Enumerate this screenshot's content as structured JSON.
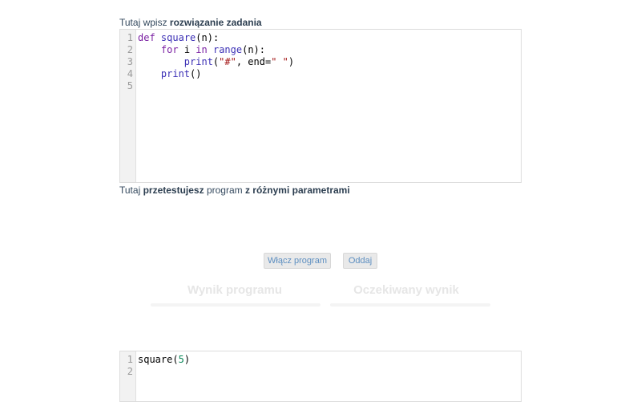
{
  "solution": {
    "label_prefix": "Tutaj wpisz ",
    "label_bold": "rozwiązanie zadania",
    "line_numbers": [
      "1",
      "2",
      "3",
      "4",
      "5"
    ],
    "code": {
      "l1_kw": "def",
      "l1_fn": "square",
      "l1_rest": "(n):",
      "l2_indent": "    ",
      "l2_kw1": "for",
      "l2_var": " i ",
      "l2_kw2": "in",
      "l2_sp": " ",
      "l2_fn": "range",
      "l2_rest": "(n):",
      "l3_indent": "        ",
      "l3_fn": "print",
      "l3_open": "(",
      "l3_str1": "\"#\"",
      "l3_mid": ", end=",
      "l3_str2": "\" \"",
      "l3_close": ")",
      "l4_indent": "    ",
      "l4_fn": "print",
      "l4_rest": "()"
    }
  },
  "test": {
    "label_prefix": "Tutaj ",
    "label_bold1": "przetestujesz",
    "label_mid": " program ",
    "label_bold2": "z różnymi parametrami",
    "line_numbers": [
      "1",
      "2"
    ],
    "code": {
      "l1_fn": "square(",
      "l1_num": "5",
      "l1_close": ")"
    }
  },
  "buttons": {
    "run": "Włącz program",
    "submit": "Oddaj"
  },
  "results": {
    "program_output": "Wynik programu",
    "expected_output": "Oczekiwany wynik"
  },
  "colors": {
    "keyword": "#7a1fa2",
    "function": "#3b2fb5",
    "string": "#a31515",
    "number": "#098658",
    "button_text": "#5d8fc1"
  }
}
